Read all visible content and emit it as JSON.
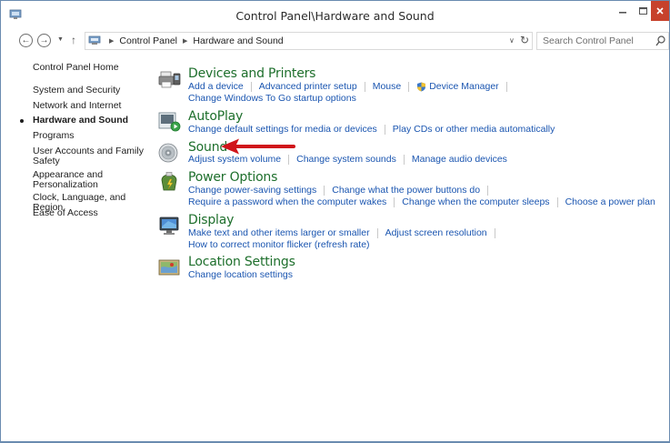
{
  "window": {
    "title": "Control Panel\\Hardware and Sound",
    "accent": "#c7412c",
    "link_color": "#1a55b0",
    "section_title_color": "#1e6f2c"
  },
  "nav": {
    "back_glyph": "←",
    "forward_glyph": "→",
    "recent_glyph": "▼",
    "up_glyph": "↑"
  },
  "address": {
    "crumbs": [
      "Control Panel",
      "Hardware and Sound"
    ],
    "dropdown_glyph": "∨",
    "refresh_glyph": "↻"
  },
  "search": {
    "placeholder": "Search Control Panel"
  },
  "leftnav": {
    "items": [
      {
        "label": "Control Panel Home"
      },
      {
        "label": "System and Security"
      },
      {
        "label": "Network and Internet"
      },
      {
        "label": "Hardware and Sound",
        "current": true
      },
      {
        "label": "Programs"
      },
      {
        "label": "User Accounts and Family Safety"
      },
      {
        "label": "Appearance and Personalization"
      },
      {
        "label": "Clock, Language, and Region"
      },
      {
        "label": "Ease of Access"
      }
    ]
  },
  "sections": {
    "devices": {
      "title": "Devices and Printers",
      "icon": "printer-icon",
      "links_row1": [
        "Add a device",
        "Advanced printer setup",
        "Mouse",
        "Device Manager"
      ],
      "links_row2": [
        "Change Windows To Go startup options"
      ]
    },
    "autoplay": {
      "title": "AutoPlay",
      "icon": "autoplay-icon",
      "links_row1": [
        "Change default settings for media or devices",
        "Play CDs or other media automatically"
      ]
    },
    "sound": {
      "title": "Sound",
      "icon": "speaker-icon",
      "links_row1": [
        "Adjust system volume",
        "Change system sounds",
        "Manage audio devices"
      ]
    },
    "power": {
      "title": "Power Options",
      "icon": "power-icon",
      "links_row1": [
        "Change power-saving settings",
        "Change what the power buttons do"
      ],
      "links_row2": [
        "Require a password when the computer wakes",
        "Change when the computer sleeps",
        "Choose a power plan"
      ]
    },
    "display": {
      "title": "Display",
      "icon": "monitor-icon",
      "links_row1": [
        "Make text and other items larger or smaller",
        "Adjust screen resolution"
      ],
      "links_row2": [
        "How to correct monitor flicker (refresh rate)"
      ]
    },
    "location": {
      "title": "Location Settings",
      "icon": "location-icon",
      "links_row1": [
        "Change location settings"
      ]
    }
  }
}
